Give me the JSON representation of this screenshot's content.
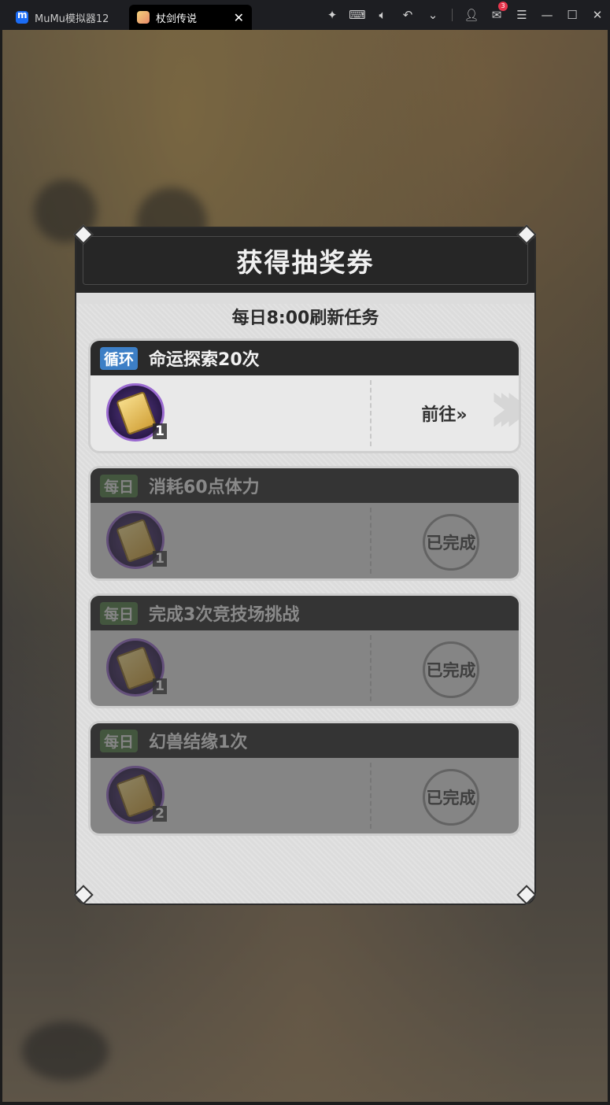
{
  "window": {
    "tabs": [
      {
        "label": "MuMu模拟器12",
        "active": false
      },
      {
        "label": "杖剑传说",
        "active": true
      }
    ],
    "mail_badge": "3",
    "toolbar_icons": [
      "pin-icon",
      "keyboard-icon",
      "volume-icon",
      "undo-icon",
      "chevron-down-icon",
      "user-icon",
      "mail-icon",
      "menu-icon",
      "minimize-icon",
      "maximize-icon",
      "close-icon"
    ]
  },
  "dialog": {
    "title": "获得抽奖券",
    "subtitle": "每日8:00刷新任务",
    "tasks": [
      {
        "tag": "循环",
        "tag_type": "cycle",
        "name": "命运探索20次",
        "reward_count": "1",
        "status": "goto",
        "action_label": "前往»",
        "completed": false
      },
      {
        "tag": "每日",
        "tag_type": "daily",
        "name": "消耗60点体力",
        "reward_count": "1",
        "status": "done",
        "action_label": "已完成",
        "completed": true
      },
      {
        "tag": "每日",
        "tag_type": "daily",
        "name": "完成3次竞技场挑战",
        "reward_count": "1",
        "status": "done",
        "action_label": "已完成",
        "completed": true
      },
      {
        "tag": "每日",
        "tag_type": "daily",
        "name": "幻兽结缘1次",
        "reward_count": "2",
        "status": "done",
        "action_label": "已完成",
        "completed": true
      }
    ]
  },
  "colors": {
    "tag_cycle": "#3d7fc6",
    "tag_daily": "#4d7a42",
    "dialog_bg": "#dcdcdc",
    "header_bg": "#262626"
  }
}
